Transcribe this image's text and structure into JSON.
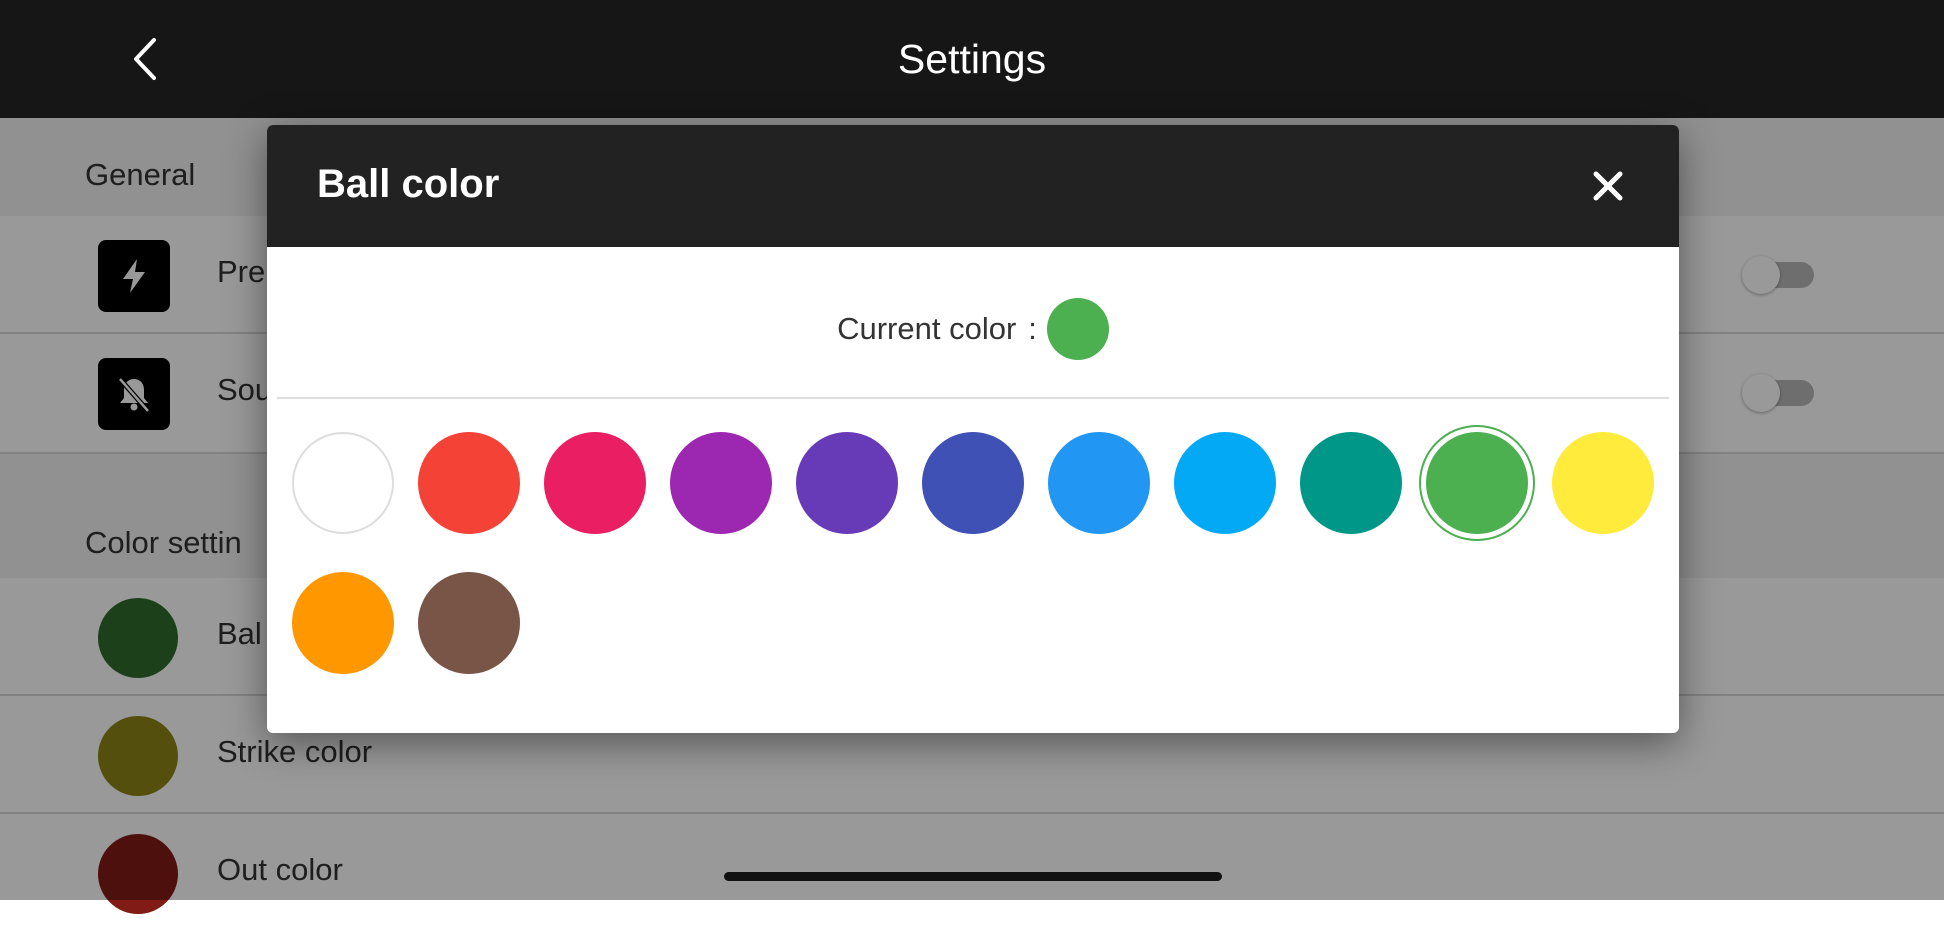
{
  "header": {
    "title": "Settings",
    "back_icon": "chevron-left-icon"
  },
  "sections": {
    "general": "General",
    "colors": "Color settin"
  },
  "general_rows": [
    {
      "label": "Pre",
      "icon": "lightning-icon",
      "toggle_on": false
    },
    {
      "label": "Sou",
      "icon": "bell-off-icon",
      "toggle_on": false
    }
  ],
  "color_rows": [
    {
      "label": "Bal",
      "color": "#2f6b2c"
    },
    {
      "label": "Strike color",
      "color": "#8c8417"
    },
    {
      "label": "Out color",
      "color": "#801b15"
    }
  ],
  "dialog": {
    "title": "Ball color",
    "close_icon": "close-icon",
    "current_label": "Current color",
    "current_separator": ":",
    "current_color": "#4caf50",
    "selected_color": "#4caf50",
    "swatches": [
      "#ffffff",
      "#f44336",
      "#e91e63",
      "#9c27b0",
      "#673ab7",
      "#3f51b5",
      "#2196f3",
      "#03a9f4",
      "#009688",
      "#4caf50",
      "#ffeb3b",
      "#ff9800",
      "#795548"
    ]
  }
}
